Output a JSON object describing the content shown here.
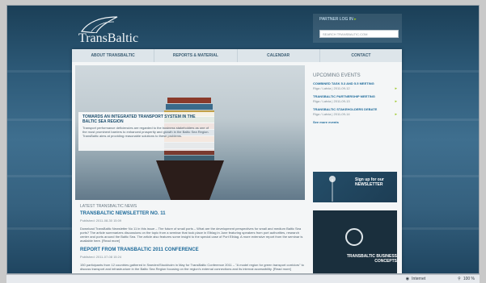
{
  "site": {
    "logo_text": "TransBaltic",
    "partner_login": "PARTNER LOG IN",
    "search_placeholder": "SEARCH TRANSBALTIC.COM"
  },
  "nav": {
    "items": [
      {
        "label": "ABOUT TRANSBALTIC"
      },
      {
        "label": "REPORTS & MATERIAL"
      },
      {
        "label": "CALENDAR"
      },
      {
        "label": "CONTACT"
      }
    ]
  },
  "hero": {
    "title": "TOWARDS AN INTEGRATED TRANSPORT SYSTEM IN THE BALTIC SEA REGION",
    "text": "Transport performance deficiencies are regarded to the business stakeholders as one of the most prominent barriers to enhanced prosperity and growth in the Baltic Sea Region. TransBaltic aims at providing reasonable solutions to these problems."
  },
  "events": {
    "heading": "UPCOMING EVENTS",
    "items": [
      {
        "title": "COMBINED TASK 5.3 AND 5.5 MEETING",
        "meta": "Riga / Latvia | 2011-09-12"
      },
      {
        "title": "TRANSBALTIC PARTNERSHIP MEETING",
        "meta": "Riga / Latvia | 2011-09-13"
      },
      {
        "title": "TRANSBALTIC STAKEHOLDERS DEBATE",
        "meta": "Riga / Latvia | 2011-09-14"
      }
    ],
    "see_more": "See more events"
  },
  "banners": {
    "signup": "Sign up for our NEWSLETTER",
    "concepts": "TRANSBALTIC BUSINESS CONCEPTS"
  },
  "news": {
    "heading": "LATEST TRANSBALTIC NEWS",
    "items": [
      {
        "title": "TRANSBALTIC NEWSLETTER NO. 11",
        "date": "Published: 2011-08-30 15:09",
        "body": "Download TransBaltic Newsletter No 11 in this issue – The future of small ports – What are the development perspectives for small and medium Baltic Sea ports? The article summarizes discussions on the topic from a seminar that took place in Elblag in June featuring speakers from port authorities, research center and ports around the Baltic Sea. The article also features some insight to the special case of Port Elblag. A more extensive report from the seminar is available here. [Read more]"
      },
      {
        "title": "REPORT FROM TRANSBALTIC 2011 CONFERENCE",
        "date": "Published: 2011-07-08 15:24",
        "body": "150 participants from 12 countries gathered in Sweden/Stockholm in May for TransBaltic Conference 2011 – \"A model region for green transport corridors\" to discuss transport and infrastructure in the Baltic Sea Region focusing on the region's external connections and its internal accessibility. [Read more]"
      }
    ]
  },
  "status": {
    "zone": "Internet",
    "zoom": "100 %"
  }
}
